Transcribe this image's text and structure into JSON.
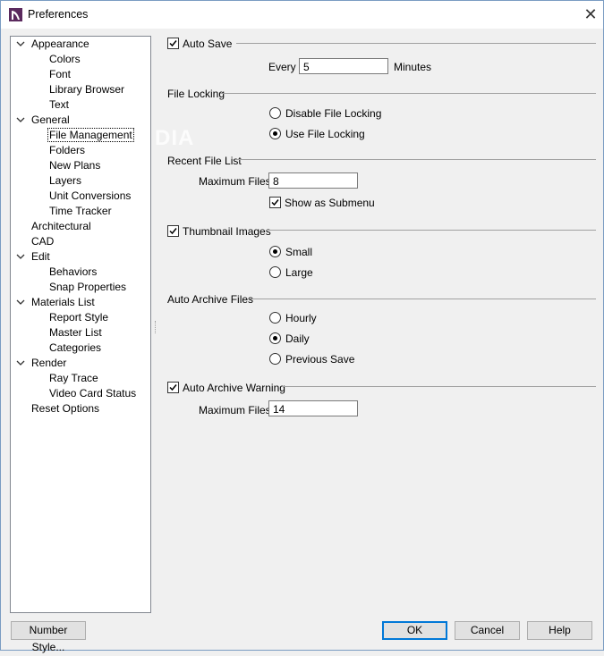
{
  "window": {
    "title": "Preferences",
    "close_symbol": "✕",
    "watermark": "DIA"
  },
  "tree": {
    "items": [
      {
        "label": "Appearance",
        "level": 0,
        "expanded": true
      },
      {
        "label": "Colors",
        "level": 1
      },
      {
        "label": "Font",
        "level": 1
      },
      {
        "label": "Library Browser",
        "level": 1
      },
      {
        "label": "Text",
        "level": 1
      },
      {
        "label": "General",
        "level": 0,
        "expanded": true
      },
      {
        "label": "File Management",
        "level": 1,
        "selected": true
      },
      {
        "label": "Folders",
        "level": 1
      },
      {
        "label": "New Plans",
        "level": 1
      },
      {
        "label": "Layers",
        "level": 1
      },
      {
        "label": "Unit Conversions",
        "level": 1
      },
      {
        "label": "Time Tracker",
        "level": 1
      },
      {
        "label": "Architectural",
        "level": 0
      },
      {
        "label": "CAD",
        "level": 0
      },
      {
        "label": "Edit",
        "level": 0,
        "expanded": true
      },
      {
        "label": "Behaviors",
        "level": 1
      },
      {
        "label": "Snap Properties",
        "level": 1
      },
      {
        "label": "Materials List",
        "level": 0,
        "expanded": true
      },
      {
        "label": "Report Style",
        "level": 1
      },
      {
        "label": "Master List",
        "level": 1
      },
      {
        "label": "Categories",
        "level": 1
      },
      {
        "label": "Render",
        "level": 0,
        "expanded": true
      },
      {
        "label": "Ray Trace",
        "level": 1
      },
      {
        "label": "Video Card Status",
        "level": 1
      },
      {
        "label": "Reset Options",
        "level": 0
      }
    ]
  },
  "auto_save": {
    "label": "Auto Save",
    "checked": true,
    "every_label": "Every",
    "every_value": "5",
    "unit": "Minutes"
  },
  "file_locking": {
    "label": "File Locking",
    "options": [
      "Disable File Locking",
      "Use File Locking"
    ],
    "selected": "Use File Locking"
  },
  "recent_files": {
    "label": "Recent File List",
    "max_label": "Maximum Files:",
    "max_value": "8",
    "submenu_label": "Show as Submenu",
    "submenu_checked": true
  },
  "thumbnails": {
    "label": "Thumbnail Images",
    "checked": true,
    "options": [
      "Small",
      "Large"
    ],
    "selected": "Small"
  },
  "auto_archive": {
    "label": "Auto Archive Files",
    "options": [
      "Hourly",
      "Daily",
      "Previous Save"
    ],
    "selected": "Daily"
  },
  "archive_warning": {
    "label": "Auto Archive Warning",
    "checked": true,
    "max_label": "Maximum Files:",
    "max_value": "14"
  },
  "buttons": {
    "number_style": "Number Style...",
    "ok": "OK",
    "cancel": "Cancel",
    "help": "Help"
  },
  "colors": {
    "accent": "#0078d7",
    "icon_color": "#5b2a5e"
  }
}
